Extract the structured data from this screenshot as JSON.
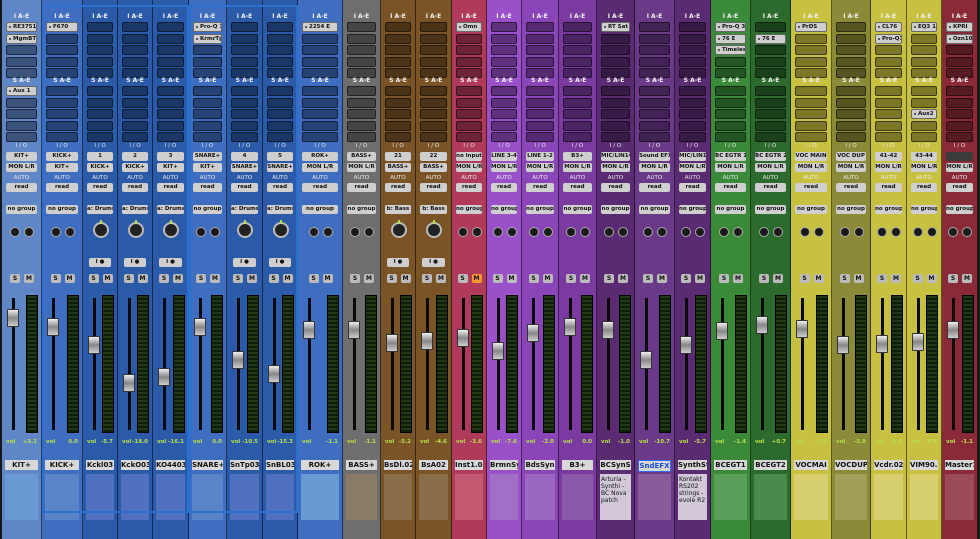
{
  "labels": {
    "inserts_ae": "I A-E",
    "sends_ae": "S A-E",
    "io": "I / O",
    "auto": "AUTO",
    "group": "no group",
    "solo": "S",
    "mute": "M",
    "vol": "vol"
  },
  "colors": {
    "blue": "#3a72c2",
    "bluedeep": "#274f99",
    "gray": "#707070",
    "brown": "#7d5a2d",
    "pink": "#c04a66",
    "purple": "#8a45b0",
    "violet": "#6f3a8a",
    "green": "#3a8c3a",
    "greendark": "#2d6a2d",
    "yellow": "#b8b232",
    "olive": "#8a8a3a",
    "maroon": "#8a2b3a"
  },
  "channels": [
    {
      "w": 40,
      "color": "#5f86c6",
      "inserts": [
        "RE3751",
        "MgmBT",
        "",
        "",
        ""
      ],
      "sends": [
        "Aux 1",
        "",
        "",
        "",
        ""
      ],
      "input": "KIT+",
      "output": "MON L/R",
      "auto": "read",
      "volume": "+3.1",
      "fader_db": 3.1,
      "name": "KIT+",
      "big": false,
      "orange_m": false,
      "swatch": "#6a9ad4",
      "comment": ""
    },
    {
      "w": 41,
      "color": "#3f6dbf",
      "inserts": [
        "F670",
        "",
        "",
        "",
        ""
      ],
      "sends": [
        "",
        "",
        "",
        "",
        ""
      ],
      "input": "KICK+",
      "output": "KIT+",
      "auto": "read",
      "volume": "0.0",
      "fader_db": 0,
      "name": "KICK+",
      "big": false,
      "orange_m": false,
      "swatch": "#5b85c8",
      "comment": ""
    },
    {
      "w": 35,
      "color": "#2b5aa8",
      "inserts": [
        "",
        "",
        "",
        "",
        ""
      ],
      "sends": [
        "",
        "",
        "",
        "",
        ""
      ],
      "input": "1",
      "output": "KICK+",
      "auto": "read",
      "volume": "-5.7",
      "fader_db": -5.7,
      "name": "Kckl03",
      "big": true,
      "orange_m": false,
      "swatch": "#5270c0",
      "comment": "",
      "bus": "a: Drums"
    },
    {
      "w": 35,
      "color": "#2b5aa8",
      "inserts": [
        "",
        "",
        "",
        "",
        ""
      ],
      "sends": [
        "",
        "",
        "",
        "",
        ""
      ],
      "input": "2",
      "output": "KICK+",
      "auto": "read",
      "volume": "-18.0",
      "fader_db": -18,
      "name": "KckO03",
      "big": true,
      "orange_m": false,
      "swatch": "#5270c0",
      "comment": "",
      "bus": "a: Drums"
    },
    {
      "w": 36,
      "color": "#2b5aa8",
      "inserts": [
        "",
        "",
        "",
        "",
        ""
      ],
      "sends": [
        "",
        "",
        "",
        "",
        ""
      ],
      "input": "3",
      "output": "KIT+",
      "auto": "read",
      "volume": "-16.1",
      "fader_db": -16.1,
      "name": "KO4403",
      "big": true,
      "orange_m": false,
      "swatch": "#5270c0",
      "comment": "",
      "bus": "a: Drums"
    },
    {
      "w": 38,
      "color": "#3f6dbf",
      "inserts": [
        "Pro-Q 3",
        "KrmrTp",
        "",
        "",
        ""
      ],
      "sends": [
        "",
        "",
        "",
        "",
        ""
      ],
      "input": "SNARE+",
      "output": "KIT+",
      "auto": "read",
      "volume": "0.0",
      "fader_db": 0,
      "name": "SNARE+",
      "big": false,
      "orange_m": false,
      "swatch": "#5b85c8",
      "comment": ""
    },
    {
      "w": 36,
      "color": "#2b5aa8",
      "inserts": [
        "",
        "",
        "",
        "",
        ""
      ],
      "sends": [
        "",
        "",
        "",
        "",
        ""
      ],
      "input": "4",
      "output": "SNARE+",
      "auto": "read",
      "volume": "-10.5",
      "fader_db": -10.5,
      "name": "SnTp03",
      "big": true,
      "orange_m": false,
      "swatch": "#5270c0",
      "comment": "",
      "bus": "a: Drums"
    },
    {
      "w": 35,
      "color": "#2b5aa8",
      "inserts": [
        "",
        "",
        "",
        "",
        ""
      ],
      "sends": [
        "",
        "",
        "",
        "",
        ""
      ],
      "input": "5",
      "output": "SNARE+",
      "auto": "read",
      "volume": "-15.3",
      "fader_db": -15.3,
      "name": "SnBL03",
      "big": true,
      "orange_m": false,
      "swatch": "#5270c0",
      "comment": "",
      "bus": "a: Drums"
    },
    {
      "w": 45,
      "color": "#3f6dbf",
      "inserts": [
        "2254 E",
        "",
        "",
        "",
        ""
      ],
      "sends": [
        "",
        "",
        "",
        "",
        ""
      ],
      "input": "ROK+",
      "output": "MON L/R",
      "auto": "read",
      "volume": "-1.1",
      "fader_db": -1.1,
      "name": "ROK+",
      "big": false,
      "orange_m": false,
      "swatch": "#6a9ad4",
      "comment": ""
    },
    {
      "w": 38,
      "color": "#6e6e6e",
      "inserts": [
        "",
        "",
        "",
        "",
        ""
      ],
      "sends": [
        "",
        "",
        "",
        "",
        ""
      ],
      "input": "BASS+",
      "output": "MON L/R",
      "auto": "read",
      "volume": "-1.1",
      "fader_db": -1.1,
      "name": "BASS+",
      "big": false,
      "orange_m": false,
      "swatch": "#8a7a66",
      "comment": ""
    },
    {
      "w": 35,
      "color": "#7a5426",
      "inserts": [
        "",
        "",
        "",
        "",
        ""
      ],
      "sends": [
        "",
        "",
        "",
        "",
        ""
      ],
      "input": "21",
      "output": "BASS+",
      "auto": "read",
      "volume": "-5.2",
      "fader_db": -5.2,
      "name": "BsDl.02",
      "big": true,
      "orange_m": false,
      "swatch": "#8a6e4a",
      "comment": "",
      "bus": "b: Bass"
    },
    {
      "w": 36,
      "color": "#7a5426",
      "inserts": [
        "",
        "",
        "",
        "",
        ""
      ],
      "sends": [
        "",
        "",
        "",
        "",
        ""
      ],
      "input": "22",
      "output": "BASS+",
      "auto": "read",
      "volume": "-4.6",
      "fader_db": -4.6,
      "name": "BsA02",
      "big": true,
      "orange_m": false,
      "swatch": "#8a6e4a",
      "comment": "",
      "bus": "b: Bass"
    },
    {
      "w": 35,
      "color": "#b03a5a",
      "inserts": [
        "Omn",
        "",
        "",
        "",
        ""
      ],
      "sends": [
        "",
        "",
        "",
        "",
        ""
      ],
      "input": "no input",
      "output": "MON L/R",
      "auto": "read",
      "volume": "-3.6",
      "fader_db": -3.6,
      "name": "Inst1.03",
      "big": false,
      "orange_m": true,
      "swatch": "#c45a72",
      "comment": ""
    },
    {
      "w": 35,
      "color": "#9a50c8",
      "inserts": [
        "",
        "",
        "",
        "",
        ""
      ],
      "sends": [
        "",
        "",
        "",
        "",
        ""
      ],
      "input": "LINE 3-4",
      "output": "MON L/R",
      "auto": "read",
      "volume": "-7.6",
      "fader_db": -7.6,
      "name": "BrmnSy",
      "big": false,
      "orange_m": false,
      "swatch": "#a070c8",
      "comment": ""
    },
    {
      "w": 37,
      "color": "#8a45b8",
      "inserts": [
        "",
        "",
        "",
        "",
        ""
      ],
      "sends": [
        "",
        "",
        "",
        "",
        ""
      ],
      "input": "LINE 1-2",
      "output": "MON L/R",
      "auto": "read",
      "volume": "-2.0",
      "fader_db": -2,
      "name": "BdsSyn",
      "big": false,
      "orange_m": false,
      "swatch": "#9a68c2",
      "comment": ""
    },
    {
      "w": 38,
      "color": "#7a3aa0",
      "inserts": [
        "",
        "",
        "",
        "",
        ""
      ],
      "sends": [
        "",
        "",
        "",
        "",
        ""
      ],
      "input": "B3+",
      "output": "MON L/R",
      "auto": "read",
      "volume": "0.0",
      "fader_db": 0,
      "name": "B3+",
      "big": false,
      "orange_m": false,
      "swatch": "#8a5aa8",
      "comment": ""
    },
    {
      "w": 38,
      "color": "#5a2a72",
      "inserts": [
        "RT Sat",
        "",
        "",
        "",
        ""
      ],
      "sends": [
        "",
        "",
        "",
        "",
        ""
      ],
      "input": "MIC/LIN14",
      "output": "MON L/R",
      "auto": "read",
      "volume": "-1.0",
      "fader_db": -1,
      "name": "BCSynS",
      "big": false,
      "orange_m": false,
      "swatch": "#d2c8d8",
      "comment": "Arturia - Synthi - BC Nova patch"
    },
    {
      "w": 40,
      "color": "#6a3a88",
      "inserts": [
        "",
        "",
        "",
        "",
        ""
      ],
      "sends": [
        "",
        "",
        "",
        "",
        ""
      ],
      "input": "Sound EFX",
      "output": "MON L/R",
      "auto": "read",
      "volume": "-10.7",
      "fader_db": -10.7,
      "name": "SndEFX",
      "big": false,
      "orange_m": false,
      "swatch": "#8a5a9a",
      "comment": "",
      "hl": true
    },
    {
      "w": 36,
      "color": "#5a2a72",
      "inserts": [
        "",
        "",
        "",
        "",
        ""
      ],
      "sends": [
        "",
        "",
        "",
        "",
        ""
      ],
      "input": "MIC/LIN13",
      "output": "MON L/R",
      "auto": "read",
      "volume": "-5.7",
      "fader_db": -5.7,
      "name": "SynthSt",
      "big": false,
      "orange_m": false,
      "swatch": "#d2c8d8",
      "comment": "Kontakt RS202 strings - evole R2"
    },
    {
      "w": 40,
      "color": "#3a8a3a",
      "inserts": [
        "Pro-Q 3",
        "76 E",
        "Timeless",
        "",
        ""
      ],
      "sends": [
        "",
        "",
        "",
        "",
        ""
      ],
      "input": "BC EGTR 1",
      "output": "MON L/R",
      "auto": "read",
      "volume": "-1.4",
      "fader_db": -1.4,
      "name": "BCEGT1",
      "big": false,
      "orange_m": false,
      "swatch": "#5aa05a",
      "comment": ""
    },
    {
      "w": 40,
      "color": "#2d6a2d",
      "inserts": [
        "",
        "76 E",
        "",
        "",
        ""
      ],
      "sends": [
        "",
        "",
        "",
        "",
        ""
      ],
      "input": "BC EGTR 2",
      "output": "MON L/R",
      "auto": "read",
      "volume": "+0.7",
      "fader_db": 0.7,
      "name": "BCEGT2",
      "big": false,
      "orange_m": false,
      "swatch": "#4a8a4a",
      "comment": ""
    },
    {
      "w": 41,
      "color": "#c8c040",
      "inserts": [
        "PrDS",
        "",
        "",
        "",
        ""
      ],
      "sends": [
        "",
        "",
        "",
        "",
        ""
      ],
      "input": "VOC MAIN",
      "output": "MON L/R",
      "auto": "read",
      "volume": "-0.6",
      "fader_db": -0.6,
      "name": "VOCMAI",
      "big": false,
      "orange_m": false,
      "swatch": "#d8d070",
      "comment": ""
    },
    {
      "w": 39,
      "color": "#8a8a38",
      "inserts": [
        "",
        "",
        "",
        "",
        ""
      ],
      "sends": [
        "",
        "",
        "",
        "",
        ""
      ],
      "input": "VOC DUP",
      "output": "MON L/R",
      "auto": "read",
      "volume": "-5.9",
      "fader_db": -5.9,
      "name": "VOCDUP",
      "big": false,
      "orange_m": false,
      "swatch": "#a0a05a",
      "comment": ""
    },
    {
      "w": 36,
      "color": "#c8c040",
      "inserts": [
        "CL76",
        "Pro-Q3",
        "",
        "",
        ""
      ],
      "sends": [
        "",
        "",
        "",
        "",
        ""
      ],
      "input": "41-42",
      "output": "MON L/R",
      "auto": "read",
      "volume": "-5.4",
      "fader_db": -5.4,
      "name": "Vcdr.02",
      "big": false,
      "orange_m": false,
      "swatch": "#d8d070",
      "comment": ""
    },
    {
      "w": 35,
      "color": "#c8c040",
      "inserts": [
        "EQ3 1",
        "",
        "",
        "",
        ""
      ],
      "sends": [
        "",
        "",
        "Aux2",
        "",
        ""
      ],
      "input": "43-44",
      "output": "MON L/R",
      "auto": "read",
      "volume": "-4.9",
      "fader_db": -4.9,
      "name": "VIM90.1",
      "big": false,
      "orange_m": false,
      "swatch": "#d8d070",
      "comment": ""
    },
    {
      "w": 36,
      "color": "#8a2a38",
      "inserts": [
        "KPRI",
        "Ozn10",
        "",
        "",
        ""
      ],
      "sends": [
        "",
        "",
        "",
        "",
        ""
      ],
      "input": "",
      "output": "MON L/R",
      "auto": "read",
      "volume": "-1.1",
      "fader_db": -1.1,
      "name": "Master1",
      "big": false,
      "orange_m": false,
      "swatch": "#9a4a58",
      "comment": ""
    }
  ]
}
